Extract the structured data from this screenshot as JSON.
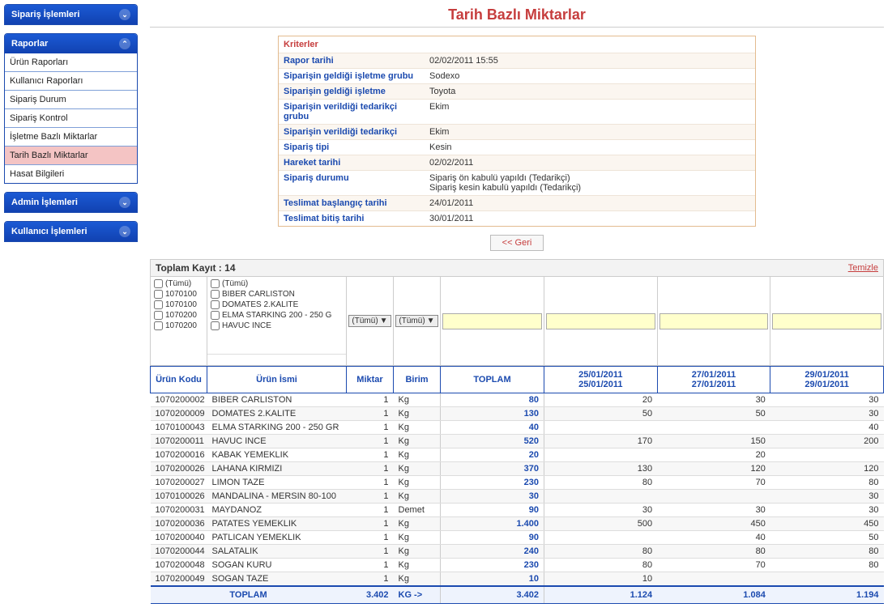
{
  "title": "Tarih Bazlı Miktarlar",
  "nav": {
    "siparis": "Sipariş İşlemleri",
    "raporlar": "Raporlar",
    "raporlar_items": [
      "Ürün Raporları",
      "Kullanıcı Raporları",
      "Sipariş Durum",
      "Sipariş Kontrol",
      "İşletme Bazlı Miktarlar",
      "Tarih Bazlı Miktarlar",
      "Hasat Bilgileri"
    ],
    "raporlar_active_index": 5,
    "admin": "Admin İşlemleri",
    "kullanici": "Kullanıcı İşlemleri"
  },
  "criteria": {
    "heading": "Kriterler",
    "rows": [
      {
        "label": "Rapor tarihi",
        "value": "02/02/2011 15:55"
      },
      {
        "label": "Siparişin geldiği işletme grubu",
        "value": "Sodexo"
      },
      {
        "label": "Siparişin geldiği işletme",
        "value": "Toyota"
      },
      {
        "label": "Siparişin verildiği tedarikçi grubu",
        "value": "Ekim"
      },
      {
        "label": "Siparişin verildiği tedarikçi",
        "value": "Ekim"
      },
      {
        "label": "Sipariş tipi",
        "value": "Kesin"
      },
      {
        "label": "Hareket tarihi",
        "value": "02/02/2011"
      },
      {
        "label": "Sipariş durumu",
        "value": "Sipariş ön kabulü yapıldı (Tedarikçi)\nSipariş kesin kabulü yapıldı (Tedarikçi)"
      },
      {
        "label": "Teslimat başlangıç tarihi",
        "value": "24/01/2011"
      },
      {
        "label": "Teslimat bitiş tarihi",
        "value": "30/01/2011"
      }
    ]
  },
  "back_btn": "<< Geri",
  "grid_top": {
    "label": "Toplam Kayıt :",
    "count": "14",
    "clear": "Temizle"
  },
  "filter_all": "(Tümü)",
  "filter_codes": [
    "1070100",
    "1070100",
    "1070200",
    "1070200"
  ],
  "filter_names": [
    "BIBER CARLISTON",
    "DOMATES 2.KALITE",
    "ELMA STARKING 200 - 250 G",
    "HAVUC INCE"
  ],
  "tumu_btn": "(Tümü)",
  "headers": {
    "code": "Ürün Kodu",
    "name": "Ürün İsmi",
    "miktar": "Miktar",
    "birim": "Birim",
    "toplam": "TOPLAM"
  },
  "date_cols": [
    {
      "d1": "25/01/2011",
      "d2": "25/01/2011"
    },
    {
      "d1": "27/01/2011",
      "d2": "27/01/2011"
    },
    {
      "d1": "29/01/2011",
      "d2": "29/01/2011"
    }
  ],
  "rows": [
    {
      "code": "1070200002",
      "name": "BIBER CARLISTON",
      "miktar": "1",
      "birim": "Kg",
      "toplam": "80",
      "v": [
        "20",
        "30",
        "30"
      ]
    },
    {
      "code": "1070200009",
      "name": "DOMATES 2.KALITE",
      "miktar": "1",
      "birim": "Kg",
      "toplam": "130",
      "v": [
        "50",
        "50",
        "30"
      ]
    },
    {
      "code": "1070100043",
      "name": "ELMA STARKING 200 - 250 GR",
      "miktar": "1",
      "birim": "Kg",
      "toplam": "40",
      "v": [
        "",
        "",
        "40"
      ]
    },
    {
      "code": "1070200011",
      "name": "HAVUC INCE",
      "miktar": "1",
      "birim": "Kg",
      "toplam": "520",
      "v": [
        "170",
        "150",
        "200"
      ]
    },
    {
      "code": "1070200016",
      "name": "KABAK YEMEKLIK",
      "miktar": "1",
      "birim": "Kg",
      "toplam": "20",
      "v": [
        "",
        "20",
        ""
      ]
    },
    {
      "code": "1070200026",
      "name": "LAHANA KIRMIZI",
      "miktar": "1",
      "birim": "Kg",
      "toplam": "370",
      "v": [
        "130",
        "120",
        "120"
      ]
    },
    {
      "code": "1070200027",
      "name": "LIMON TAZE",
      "miktar": "1",
      "birim": "Kg",
      "toplam": "230",
      "v": [
        "80",
        "70",
        "80"
      ]
    },
    {
      "code": "1070100026",
      "name": "MANDALINA - MERSIN 80-100",
      "miktar": "1",
      "birim": "Kg",
      "toplam": "30",
      "v": [
        "",
        "",
        "30"
      ]
    },
    {
      "code": "1070200031",
      "name": "MAYDANOZ",
      "miktar": "1",
      "birim": "Demet",
      "toplam": "90",
      "v": [
        "30",
        "30",
        "30"
      ]
    },
    {
      "code": "1070200036",
      "name": "PATATES YEMEKLIK",
      "miktar": "1",
      "birim": "Kg",
      "toplam": "1.400",
      "v": [
        "500",
        "450",
        "450"
      ]
    },
    {
      "code": "1070200040",
      "name": "PATLICAN YEMEKLIK",
      "miktar": "1",
      "birim": "Kg",
      "toplam": "90",
      "v": [
        "",
        "40",
        "50"
      ]
    },
    {
      "code": "1070200044",
      "name": "SALATALIK",
      "miktar": "1",
      "birim": "Kg",
      "toplam": "240",
      "v": [
        "80",
        "80",
        "80"
      ]
    },
    {
      "code": "1070200048",
      "name": "SOGAN KURU",
      "miktar": "1",
      "birim": "Kg",
      "toplam": "230",
      "v": [
        "80",
        "70",
        "80"
      ]
    },
    {
      "code": "1070200049",
      "name": "SOGAN TAZE",
      "miktar": "1",
      "birim": "Kg",
      "toplam": "10",
      "v": [
        "10",
        "",
        ""
      ]
    }
  ],
  "footer": {
    "label": "TOPLAM",
    "miktar": "3.402",
    "birim": "KG ->",
    "toplam": "3.402",
    "v": [
      "1.124",
      "1.084",
      "1.194"
    ]
  }
}
